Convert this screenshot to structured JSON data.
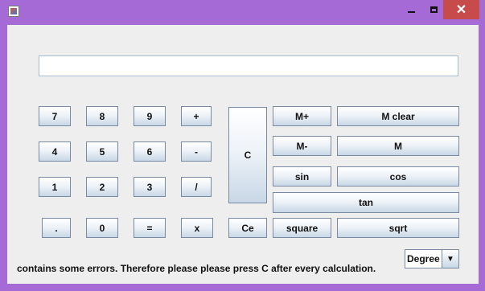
{
  "window": {
    "minimize_icon": "minimize-icon",
    "maximize_icon": "maximize-icon",
    "close_label": "✕"
  },
  "display": {
    "value": ""
  },
  "keys": {
    "k7": "7",
    "k8": "8",
    "k9": "9",
    "plus": "+",
    "k4": "4",
    "k5": "5",
    "k6": "6",
    "minus": "-",
    "k1": "1",
    "k2": "2",
    "k3": "3",
    "divide": "/",
    "dot": ".",
    "k0": "0",
    "equals": "=",
    "multiply": "x",
    "clear": "C",
    "clear_entry": "Ce",
    "m_plus": "M+",
    "m_clear": "M clear",
    "m_minus": "M-",
    "m_recall": "M",
    "sin": "sin",
    "cos": "cos",
    "tan": "tan",
    "square": "square",
    "sqrt": "sqrt"
  },
  "status_message": "contains some errors. Therefore please please press C after every calculation.",
  "angle_mode": {
    "selected": "Degree"
  },
  "colors": {
    "window_frame": "#a56ad6",
    "close_button": "#c74b4b"
  }
}
